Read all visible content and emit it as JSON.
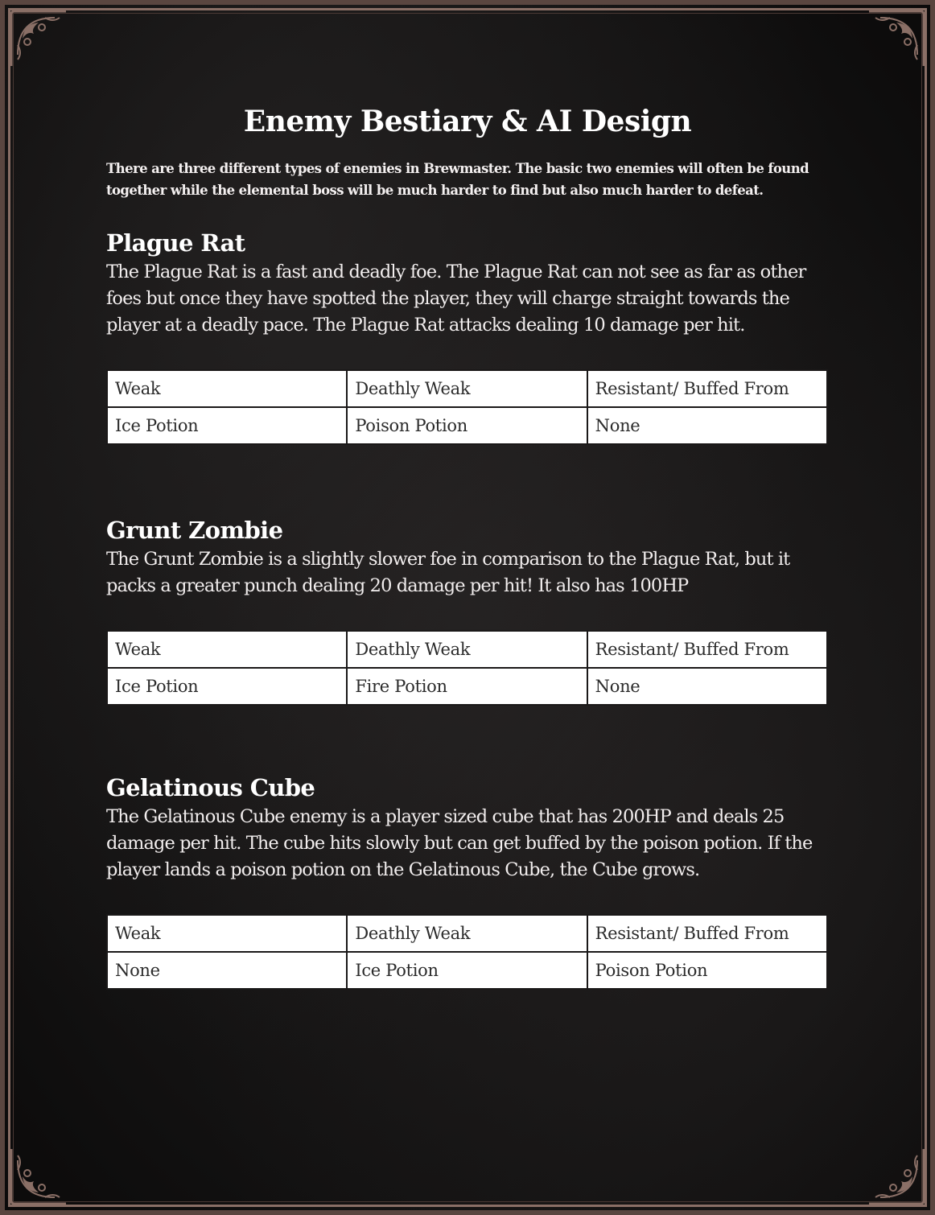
{
  "page": {
    "title": "Enemy Bestiary & AI Design",
    "intro": "There are three different types of enemies in Brewmaster. The basic two enemies will often be found together while the elemental boss will be much harder to find but also much harder to defeat."
  },
  "table_headers": {
    "weak": "Weak",
    "deathly_weak": "Deathly Weak",
    "resistant": "Resistant/ Buffed From"
  },
  "enemies": [
    {
      "name": "Plague Rat",
      "description": "The Plague Rat is a fast and deadly foe. The Plague Rat can not see as far as other foes but once they have spotted the player, they will charge straight towards the player at a deadly pace. The Plague Rat attacks dealing 10 damage per hit.",
      "weak": "Ice Potion",
      "deathly_weak": "Poison Potion",
      "resistant": "None"
    },
    {
      "name": "Grunt Zombie",
      "description": "The Grunt Zombie is a slightly slower foe in comparison to the Plague Rat, but it packs a greater punch dealing 20 damage per hit! It also has 100HP",
      "weak": "Ice Potion",
      "deathly_weak": "Fire Potion",
      "resistant": "None"
    },
    {
      "name": "Gelatinous Cube",
      "description": "The Gelatinous Cube enemy is a player sized cube that has 200HP and deals 25 damage per hit. The cube hits slowly but can get buffed by the poison potion. If the player lands a poison potion on the Gelatinous Cube, the Cube grows.",
      "weak": "None",
      "deathly_weak": "Ice Potion",
      "resistant": "Poison Potion"
    }
  ],
  "colors": {
    "background": "#141212",
    "frame": "#8a6f66",
    "text": "#f2eeee",
    "table_bg": "#ffffff",
    "table_text": "#2b2b2b"
  },
  "icons": {
    "corners": "ornate-corner-flourish"
  }
}
